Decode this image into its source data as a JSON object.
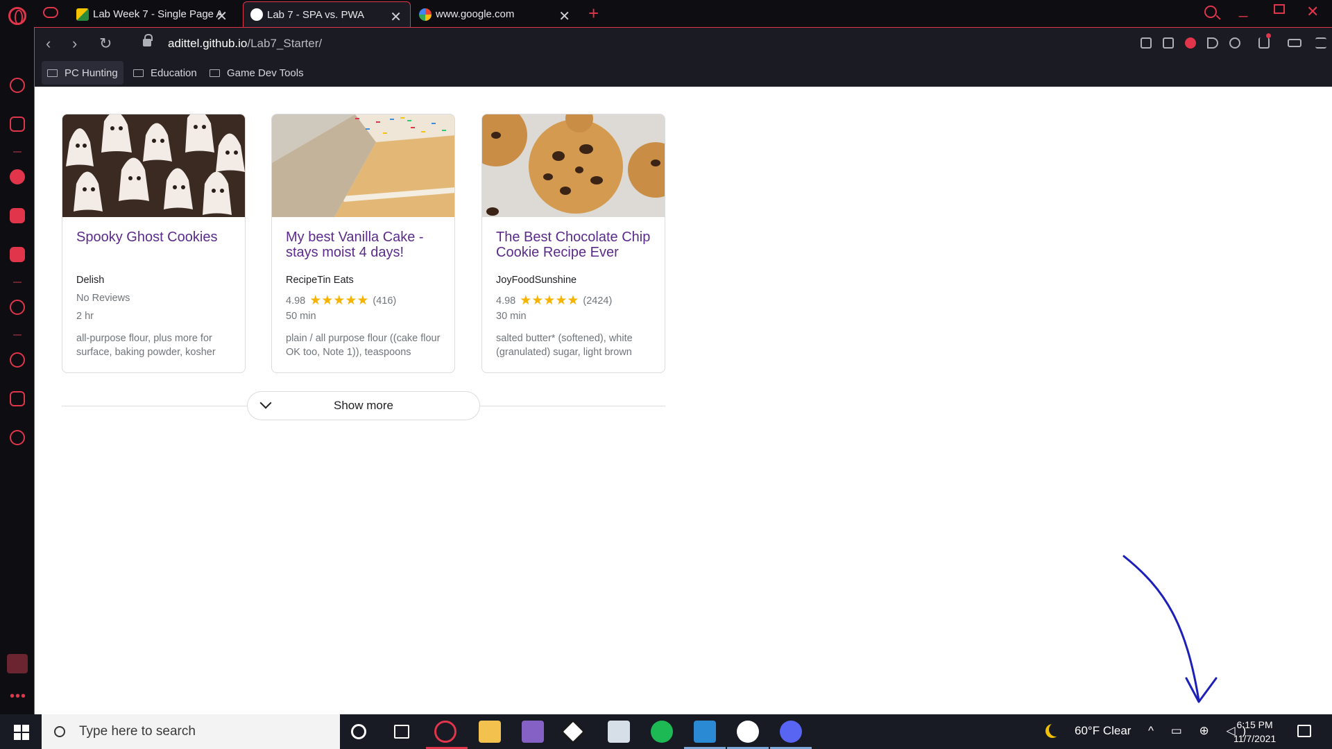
{
  "browser": {
    "tabs": [
      {
        "title": "Lab Week 7 - Single Page A",
        "active": false
      },
      {
        "title": "Lab 7 - SPA vs. PWA",
        "active": true
      },
      {
        "title": "www.google.com",
        "active": false
      }
    ],
    "new_tab_label": "+",
    "url_host": "adittel.github.io",
    "url_path": "/Lab7_Starter/",
    "bookmarks": [
      "PC Hunting",
      "Education",
      "Game Dev Tools"
    ],
    "accent_color": "#e0354b"
  },
  "recipes": [
    {
      "title": "Spooky Ghost Cookies",
      "source": "Delish",
      "rating": "",
      "stars": "",
      "reviews": "No Reviews",
      "time": "2 hr",
      "ingredients": "all-purpose flour, plus more for surface, baking powder, kosher"
    },
    {
      "title": "My best Vanilla Cake - stays moist 4 days!",
      "source": "RecipeTin Eats",
      "rating": "4.98",
      "stars": "★★★★★",
      "reviews": "(416)",
      "time": "50 min",
      "ingredients": "plain / all purpose flour ((cake flour OK too, Note 1)), teaspoons"
    },
    {
      "title": "The Best Chocolate Chip Cookie Recipe Ever",
      "source": "JoyFoodSunshine",
      "rating": "4.98",
      "stars": "★★★★★",
      "reviews": "(2424)",
      "time": "30 min",
      "ingredients": "salted butter* (softened), white (granulated) sugar, light brown"
    }
  ],
  "show_more_label": "Show more",
  "taskbar": {
    "search_placeholder": "Type here to search",
    "weather": "60°F  Clear",
    "time": "6:15 PM",
    "date": "11/7/2021"
  }
}
